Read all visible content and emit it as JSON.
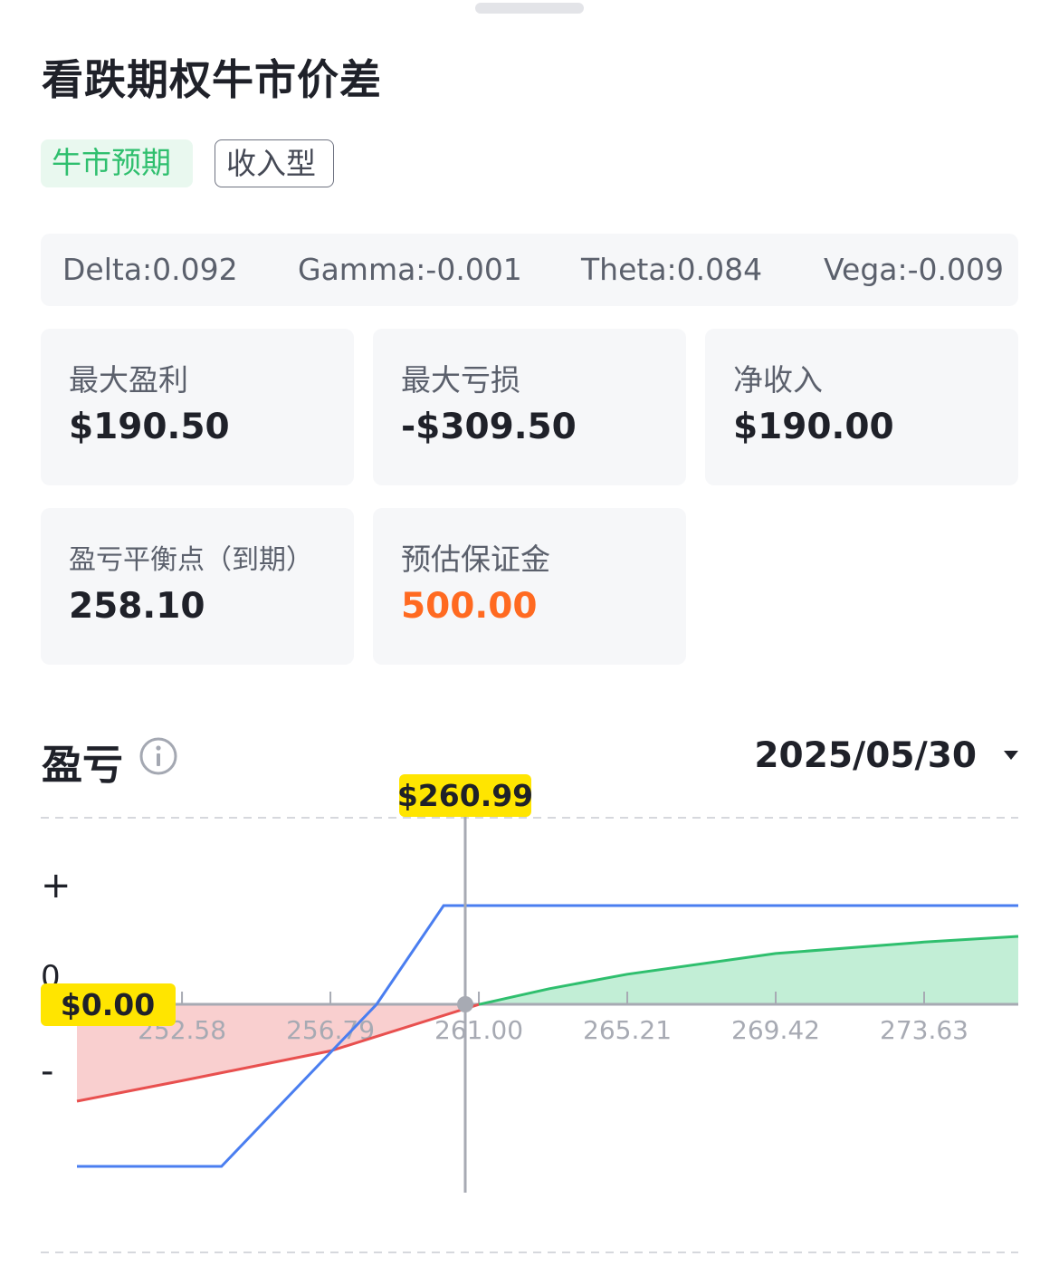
{
  "title": "看跌期权牛市价差",
  "tags": [
    "牛市预期",
    "收入型"
  ],
  "greeks": {
    "delta": "Delta:0.092",
    "gamma": "Gamma:-0.001",
    "theta": "Theta:0.084",
    "vega": "Vega:-0.009"
  },
  "metrics": {
    "max_profit": {
      "label": "最大盈利",
      "value": "$190.50"
    },
    "max_loss": {
      "label": "最大亏损",
      "value": "-$309.50"
    },
    "net_income": {
      "label": "净收入",
      "value": "$190.00"
    },
    "breakeven": {
      "label": "盈亏平衡点（到期）",
      "value": "258.10"
    },
    "margin": {
      "label": "预估保证金",
      "value": "500.00"
    }
  },
  "pl_section": {
    "title": "盈亏",
    "date": "2025/05/30"
  },
  "colors": {
    "green": "#2fbf6e",
    "orange": "#ff6a21",
    "blue": "#4a7ef0",
    "red": "#e8504f",
    "highlight": "#ffe500"
  },
  "chart_data": {
    "type": "line",
    "x_ticks": [
      "252.58",
      "256.79",
      "261.00",
      "265.21",
      "269.42",
      "273.63"
    ],
    "y_labels": {
      "plus": "+",
      "zero": "0",
      "minus": "-"
    },
    "price_marker": "$260.99",
    "pnl_marker": "$0.00",
    "xlim": [
      249.6,
      276.3
    ],
    "ylim": [
      -309.5,
      190.5
    ],
    "series": [
      {
        "kind": "expiry",
        "points": [
          [
            249.6,
            -309.5
          ],
          [
            253.7,
            -309.5
          ],
          [
            258.1,
            0
          ],
          [
            260.0,
            190.5
          ],
          [
            276.3,
            190.5
          ]
        ]
      },
      {
        "kind": "current",
        "points": [
          [
            249.6,
            -185
          ],
          [
            252.58,
            -146
          ],
          [
            256.79,
            -89
          ],
          [
            261.0,
            -0.4
          ],
          [
            263.0,
            30
          ],
          [
            265.21,
            58
          ],
          [
            269.42,
            98
          ],
          [
            273.63,
            120
          ],
          [
            276.3,
            131
          ]
        ]
      }
    ]
  }
}
